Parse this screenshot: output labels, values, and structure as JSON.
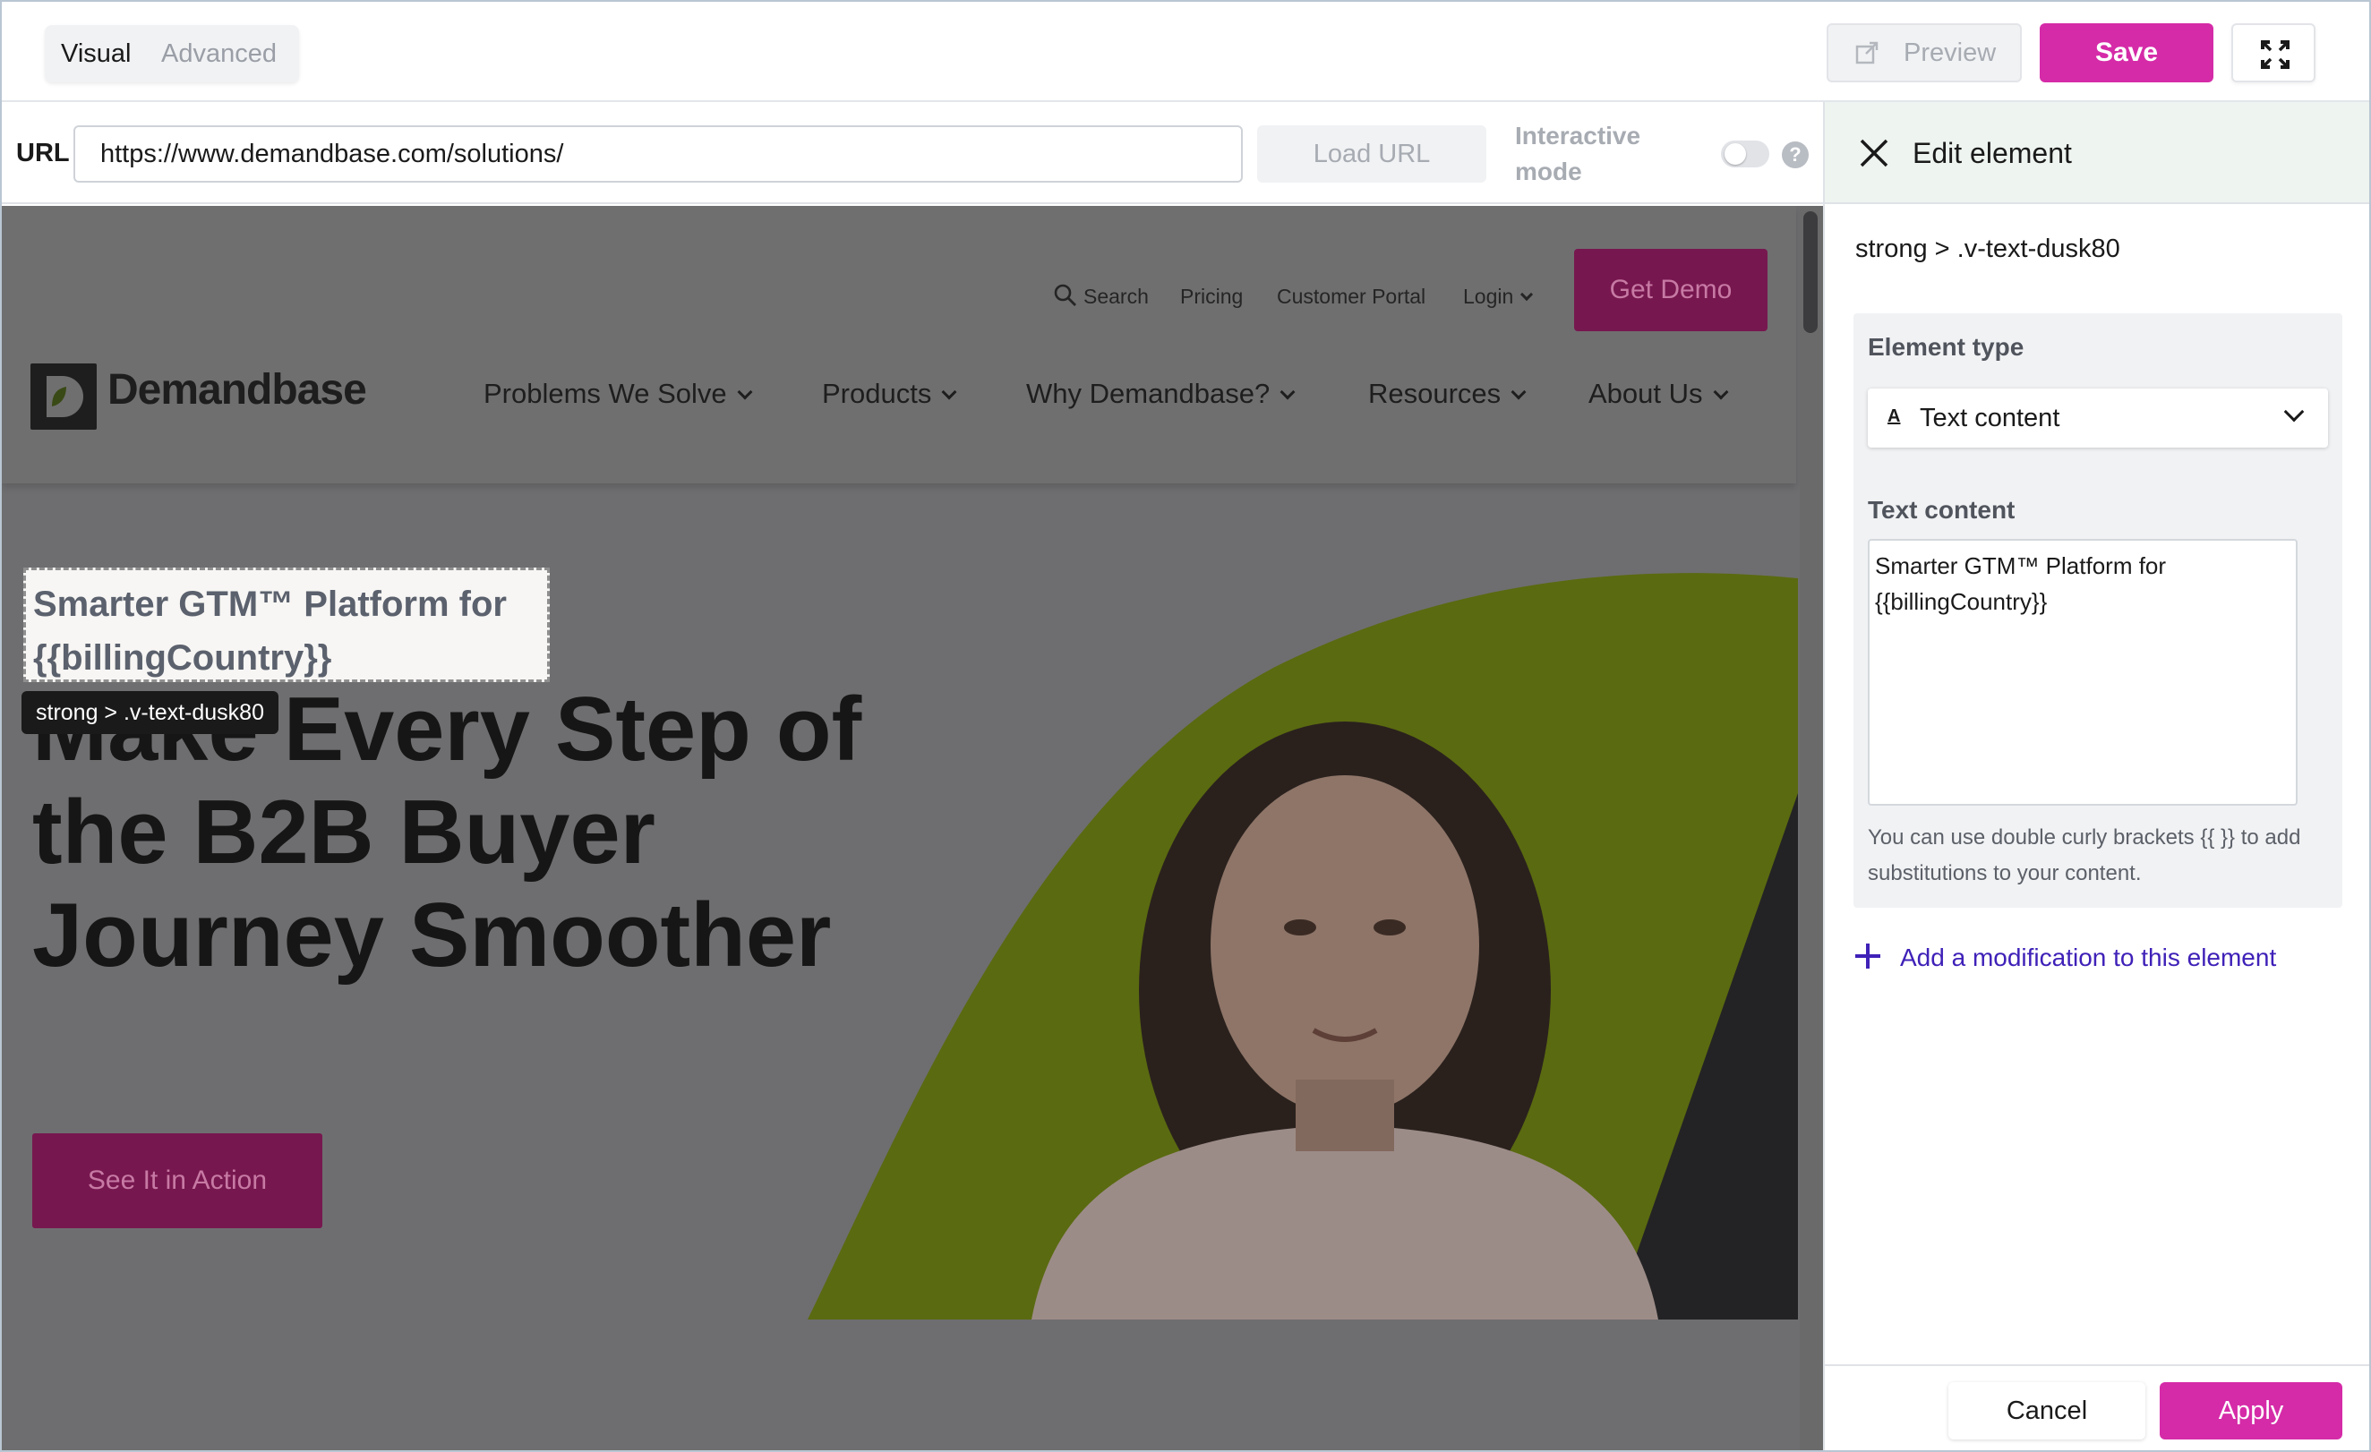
{
  "toolbar": {
    "mode_tabs": [
      {
        "label": "Visual",
        "active": true
      },
      {
        "label": "Advanced",
        "active": false
      }
    ],
    "preview_label": "Preview",
    "save_label": "Save",
    "fullscreen_icon": "expand-icon"
  },
  "urlbar": {
    "label": "URL",
    "value": "https://www.demandbase.com/solutions/",
    "load_label": "Load URL",
    "interactive_label": "Interactive mode",
    "interactive_on": false,
    "help_glyph": "?"
  },
  "site": {
    "utility_links": [
      "Search",
      "Pricing",
      "Customer Portal",
      "Login"
    ],
    "get_demo": "Get Demo",
    "logo_mark": "D",
    "logo_text": "Demandbase",
    "nav": [
      "Problems We Solve",
      "Products",
      "Why Demandbase?",
      "Resources",
      "About Us"
    ],
    "hero_heading": "Make Every Step of the B2B Buyer Journey Smoother",
    "cta": "See It in Action",
    "selected_text_line1": "Smarter GTM™ Platform for",
    "selected_text_line2": "{{billingCountry}}",
    "selected_tooltip": "strong > .v-text-dusk80"
  },
  "panel": {
    "title": "Edit element",
    "selector": "strong > .v-text-dusk80",
    "element_type_label": "Element type",
    "element_type_value": "Text content",
    "text_content_label": "Text content",
    "text_content_value": "Smarter GTM™ Platform for {{billingCountry}}",
    "hint": "You can use double curly brackets {{ }} to add substitutions to your content.",
    "add_modification": "Add a modification to this element",
    "cancel_label": "Cancel",
    "apply_label": "Apply"
  },
  "colors": {
    "accent": "#d52ba8",
    "link": "#3f21b8",
    "site_brand": "#77174f",
    "hero_lime": "#a9c21c"
  }
}
